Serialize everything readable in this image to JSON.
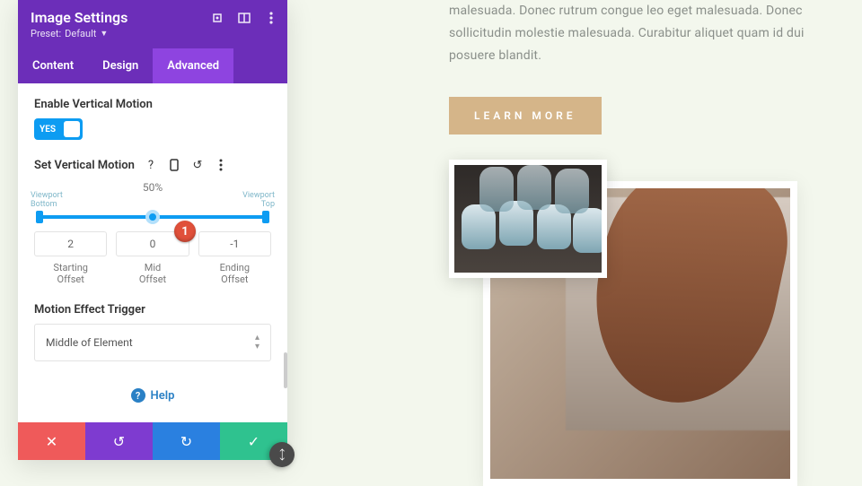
{
  "page": {
    "paragraph": "malesuada. Donec rutrum congue leo eget malesuada. Donec sollicitudin molestie malesuada. Curabitur aliquet quam id dui posuere blandit.",
    "cta": "LEARN MORE"
  },
  "panel": {
    "title": "Image Settings",
    "preset_label": "Preset:",
    "preset_value": "Default",
    "tabs": {
      "content": "Content",
      "design": "Design",
      "advanced": "Advanced"
    },
    "enable_vertical_label": "Enable Vertical Motion",
    "toggle_text": "YES",
    "set_vertical_label": "Set Vertical Motion",
    "percent": "50%",
    "viewport_bottom": "Viewport\nBottom",
    "viewport_top": "Viewport\nTop",
    "offsets": {
      "start": {
        "value": "2",
        "label": "Starting\nOffset"
      },
      "mid": {
        "value": "0",
        "label": "Mid\nOffset"
      },
      "end": {
        "value": "-1",
        "label": "Ending\nOffset"
      }
    },
    "trigger_label": "Motion Effect Trigger",
    "trigger_value": "Middle of Element",
    "help": "Help"
  },
  "callout": "1",
  "colors": {
    "accent": "#6c2eb9",
    "blue": "#0d9cf2"
  }
}
